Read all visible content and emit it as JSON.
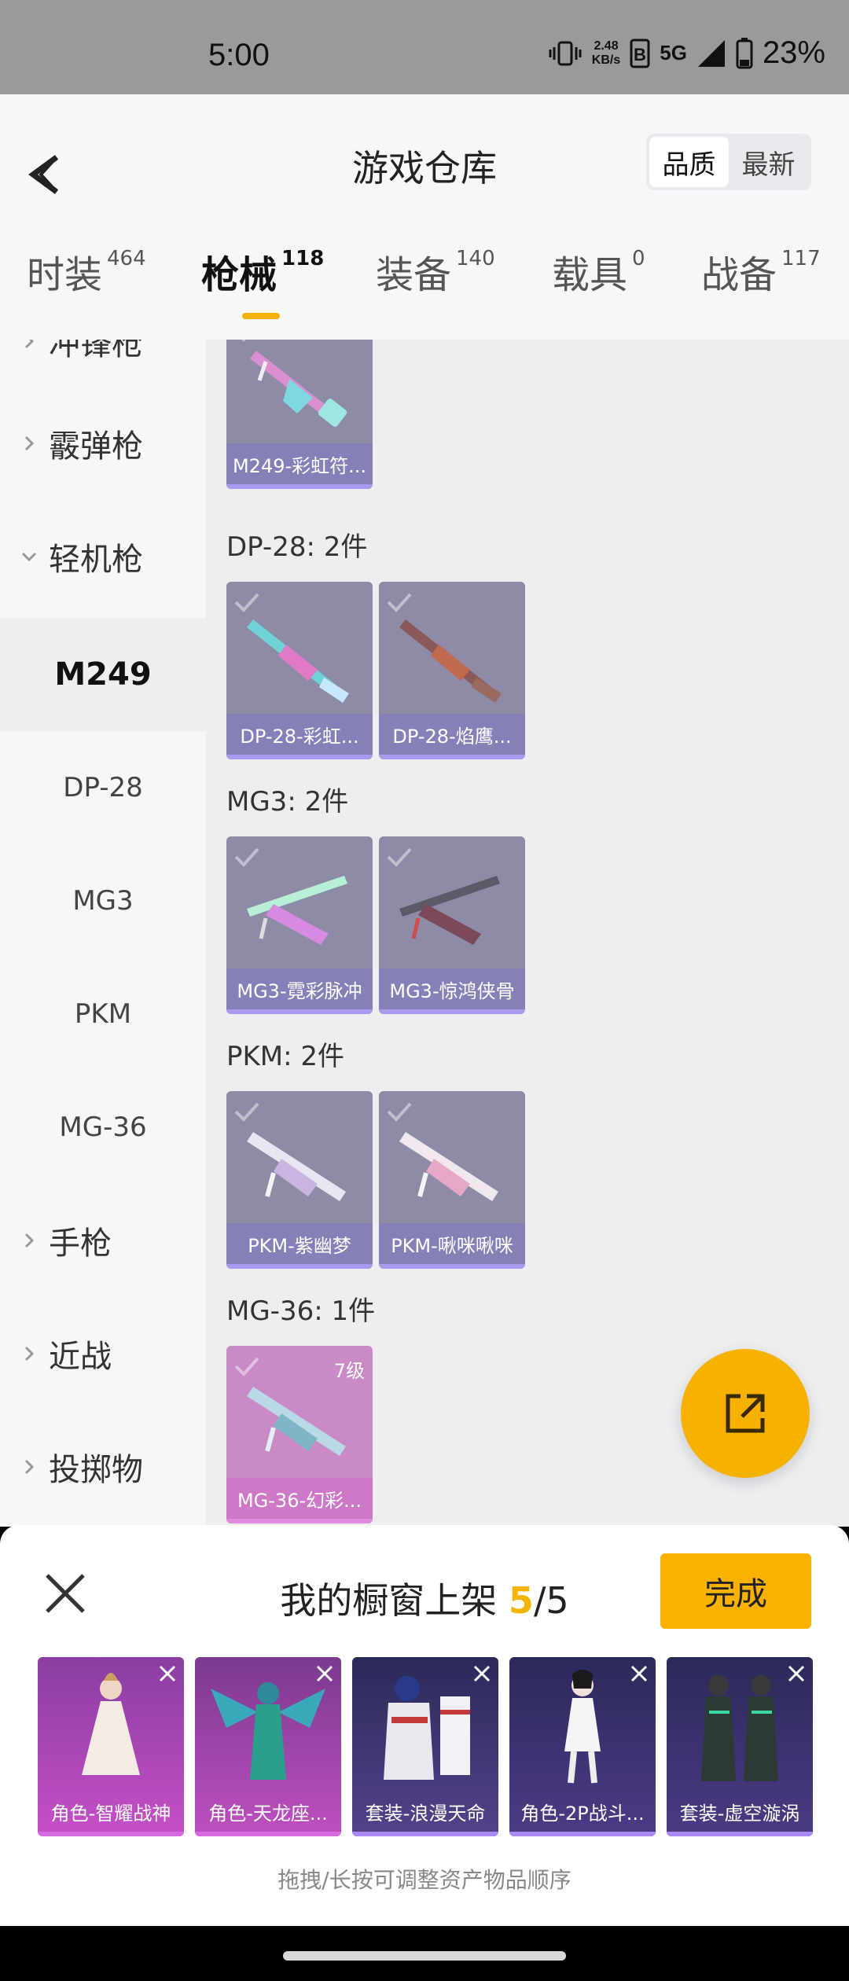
{
  "status_bar": {
    "time": "5:00",
    "net_speed_value": "2.48",
    "net_speed_unit": "KB/s",
    "network_type": "5G",
    "battery": "23%"
  },
  "header": {
    "title": "游戏仓库",
    "sort_options": [
      "品质",
      "最新"
    ],
    "sort_selected": "品质"
  },
  "tabs": [
    {
      "label": "时装",
      "count": "464"
    },
    {
      "label": "枪械",
      "count": "118",
      "active": true
    },
    {
      "label": "装备",
      "count": "140"
    },
    {
      "label": "载具",
      "count": "0"
    },
    {
      "label": "战备",
      "count": "117"
    }
  ],
  "sidebar": {
    "items": [
      {
        "label": "冲锋枪"
      },
      {
        "label": "霰弹枪"
      },
      {
        "label": "轻机枪"
      },
      {
        "label": "M249"
      },
      {
        "label": "DP-28"
      },
      {
        "label": "MG3"
      },
      {
        "label": "PKM"
      },
      {
        "label": "MG-36"
      },
      {
        "label": "手枪"
      },
      {
        "label": "近战"
      },
      {
        "label": "投掷物"
      }
    ]
  },
  "content": {
    "groups": [
      {
        "title": "",
        "items": [
          {
            "name": "M249-彩虹符..."
          }
        ]
      },
      {
        "title": "DP-28: 2件",
        "items": [
          {
            "name": "DP-28-彩虹..."
          },
          {
            "name": "DP-28-焰鹰..."
          }
        ]
      },
      {
        "title": "MG3: 2件",
        "items": [
          {
            "name": "MG3-霓彩脉冲"
          },
          {
            "name": "MG3-惊鸿侠骨"
          }
        ]
      },
      {
        "title": "PKM: 2件",
        "items": [
          {
            "name": "PKM-紫幽梦"
          },
          {
            "name": "PKM-啾咪啾咪"
          }
        ]
      },
      {
        "title": "MG-36: 1件",
        "items": [
          {
            "name": "MG-36-幻彩...",
            "level": "7级"
          }
        ]
      }
    ]
  },
  "showcase": {
    "title_prefix": "我的橱窗上架",
    "count_current": "5",
    "count_sep": "/5",
    "done_label": "完成",
    "items": [
      {
        "name": "角色-智耀战神"
      },
      {
        "name": "角色-天龙座..."
      },
      {
        "name": "套装-浪漫天命"
      },
      {
        "name": "角色-2P战斗..."
      },
      {
        "name": "套装-虚空漩涡"
      }
    ],
    "hint": "拖拽/长按可调整资产物品顺序"
  },
  "colors": {
    "accent": "#f7b200",
    "card_purple": "#8d8ba6",
    "card_pink": "#c98ac6"
  },
  "icons": [
    "back-arrow-icon",
    "chevron-right-icon",
    "chevron-down-icon",
    "check-icon",
    "export-icon",
    "close-icon"
  ]
}
